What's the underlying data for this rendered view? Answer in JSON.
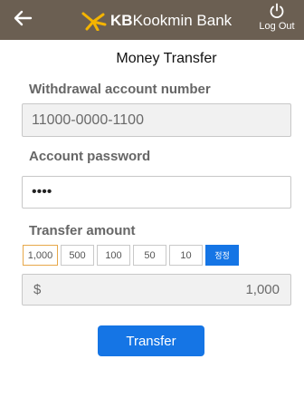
{
  "header": {
    "brand_kb": "KB",
    "brand_name": "Kookmin Bank",
    "logout_label": "Log Out",
    "back_icon": "arrow-left-icon",
    "logo_icon": "kb-star-logo",
    "power_icon": "power-icon",
    "background_color": "#6b5f52",
    "logo_color": "#f4b400"
  },
  "page": {
    "title": "Money Transfer"
  },
  "withdrawal": {
    "label": "Withdrawal account number",
    "value": "11000-0000-1100"
  },
  "password": {
    "label": "Account password",
    "value": "••••"
  },
  "amount": {
    "label": "Transfer amount",
    "quick_buttons": [
      "1,000",
      "500",
      "100",
      "50",
      "10"
    ],
    "selected_quick": "1,000",
    "correct_label": "정정",
    "currency": "$",
    "value": "1,000"
  },
  "actions": {
    "transfer_label": "Transfer",
    "accent_color": "#1575e5"
  }
}
